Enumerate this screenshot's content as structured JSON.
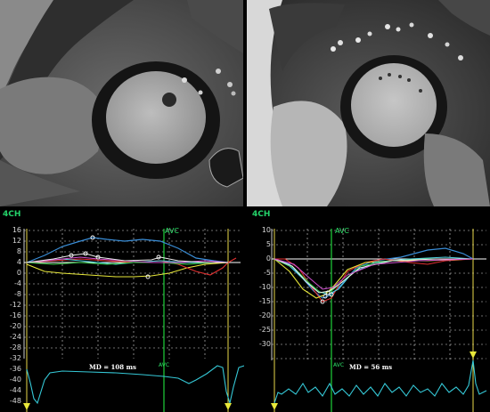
{
  "left_strain": {
    "view_tag": "4CH",
    "avc_label": "AVC",
    "avc_bottom_label": "AVC",
    "md_text": "MD = 108 ms",
    "y_ticks": [
      "16",
      "12",
      "8",
      "4",
      "0",
      "-4",
      "-8",
      "-12",
      "-16",
      "-20",
      "-24",
      "-28",
      "-32",
      "-36",
      "-40",
      "-44",
      "-48"
    ]
  },
  "right_strain": {
    "view_tag": "4CH",
    "avc_label": "AVC",
    "avc_bottom_label": "AVC",
    "md_text": "MD = 56 ms",
    "y_ticks": [
      "10",
      "5",
      "0",
      "-5",
      "-10",
      "-15",
      "-20",
      "-25",
      "-30"
    ]
  },
  "colors": {
    "avc_line": "#1fd03a",
    "grid": "#dcdcdc",
    "ecg": "#35c8d6",
    "marker": "#e8e830"
  }
}
